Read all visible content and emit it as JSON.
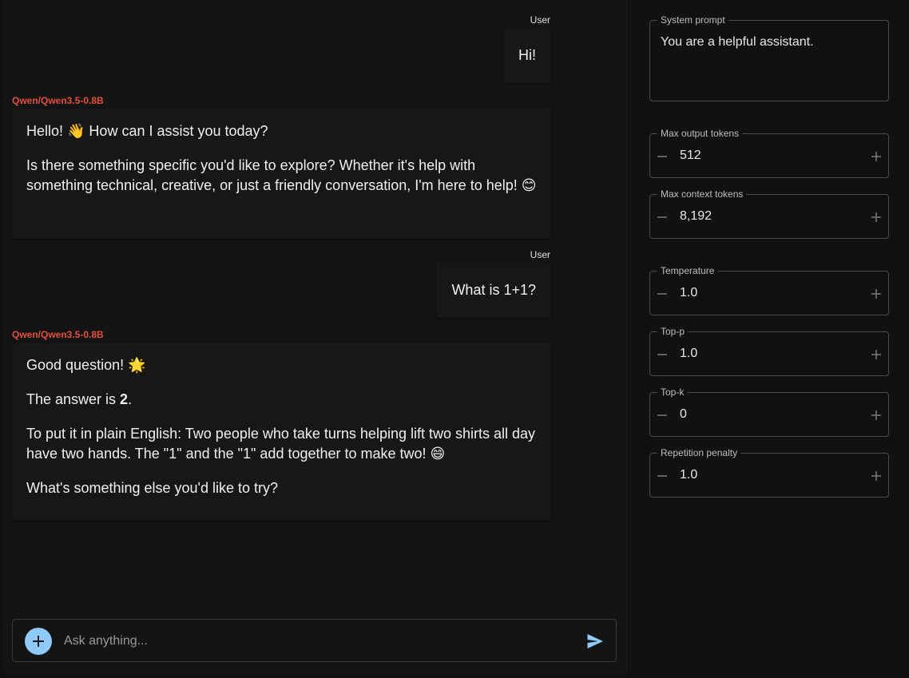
{
  "chat": {
    "messages": [
      {
        "role": "user",
        "sender": "User",
        "text": "Hi!"
      },
      {
        "role": "assistant",
        "sender": "Qwen/Qwen3.5-0.8B",
        "p1": "Hello! 👋 How can I assist you today?",
        "p2": "Is there something specific you'd like to explore? Whether it's help with something technical, creative, or just a friendly conversation, I'm here to help! 😊"
      },
      {
        "role": "user",
        "sender": "User",
        "text": "What is 1+1?"
      },
      {
        "role": "assistant",
        "sender": "Qwen/Qwen3.5-0.8B",
        "p1": "Good question! 🌟",
        "p2_prefix": "The answer is ",
        "p2_bold": "2",
        "p2_suffix": ".",
        "p3": "To put it in plain English: Two people who take turns helping lift two shirts all day have two hands. The \"1\" and the \"1\" add together to make two! 😄",
        "p4": "What's something else you'd like to try?"
      }
    ]
  },
  "input": {
    "placeholder": "Ask anything...",
    "value": "",
    "attach_icon": "plus-icon",
    "send_icon": "send-icon",
    "accent": "#90caf9"
  },
  "settings": {
    "system_prompt": {
      "label": "System prompt",
      "value": "You are a helpful assistant."
    },
    "max_output_tokens": {
      "label": "Max output tokens",
      "value": "512"
    },
    "max_context_tokens": {
      "label": "Max context tokens",
      "value": "8,192"
    },
    "temperature": {
      "label": "Temperature",
      "value": "1.0"
    },
    "top_p": {
      "label": "Top-p",
      "value": "1.0"
    },
    "top_k": {
      "label": "Top-k",
      "value": "0"
    },
    "repetition_penalty": {
      "label": "Repetition penalty",
      "value": "1.0"
    }
  },
  "colors": {
    "background": "#111111",
    "model_name": "#e2503e",
    "accent": "#90caf9"
  }
}
